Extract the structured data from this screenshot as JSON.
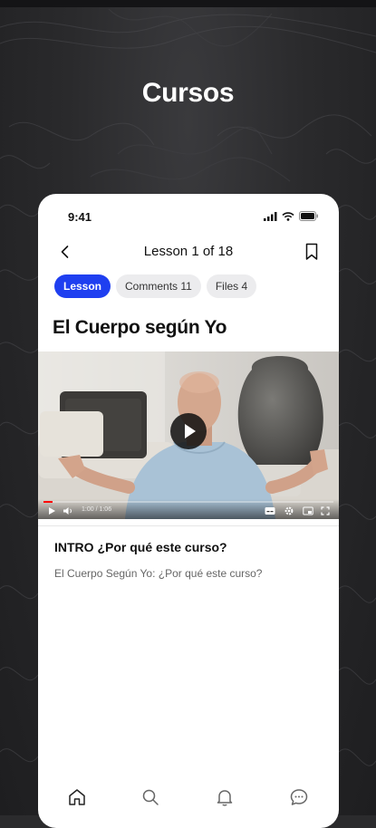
{
  "promo": {
    "headline": "Cursos"
  },
  "status_bar": {
    "time": "9:41",
    "icons": [
      "signal-icon",
      "wifi-icon",
      "battery-icon"
    ]
  },
  "header": {
    "back_icon": "chevron-left-icon",
    "title": "Lesson 1 of 18",
    "bookmark_icon": "bookmark-icon"
  },
  "tabs": [
    {
      "label": "Lesson",
      "active": true
    },
    {
      "label": "Comments 11",
      "active": false
    },
    {
      "label": "Files 4",
      "active": false
    }
  ],
  "lesson": {
    "title": "El Cuerpo según Yo"
  },
  "video": {
    "time": "1:00 / 1:06",
    "progress": 0.03,
    "controls": [
      "play-icon",
      "volume-icon",
      "subtitles-icon",
      "settings-icon",
      "miniplayer-icon",
      "fullscreen-icon"
    ]
  },
  "intro": {
    "title": "INTRO ¿Por qué este curso?",
    "description": "El Cuerpo Según Yo: ¿Por qué este curso?"
  },
  "bottom_nav": [
    "home-icon",
    "search-icon",
    "bell-icon",
    "chat-icon"
  ],
  "colors": {
    "accent": "#1f3ff0",
    "background": "#2b2b2d",
    "tab_inactive": "#ececee"
  }
}
